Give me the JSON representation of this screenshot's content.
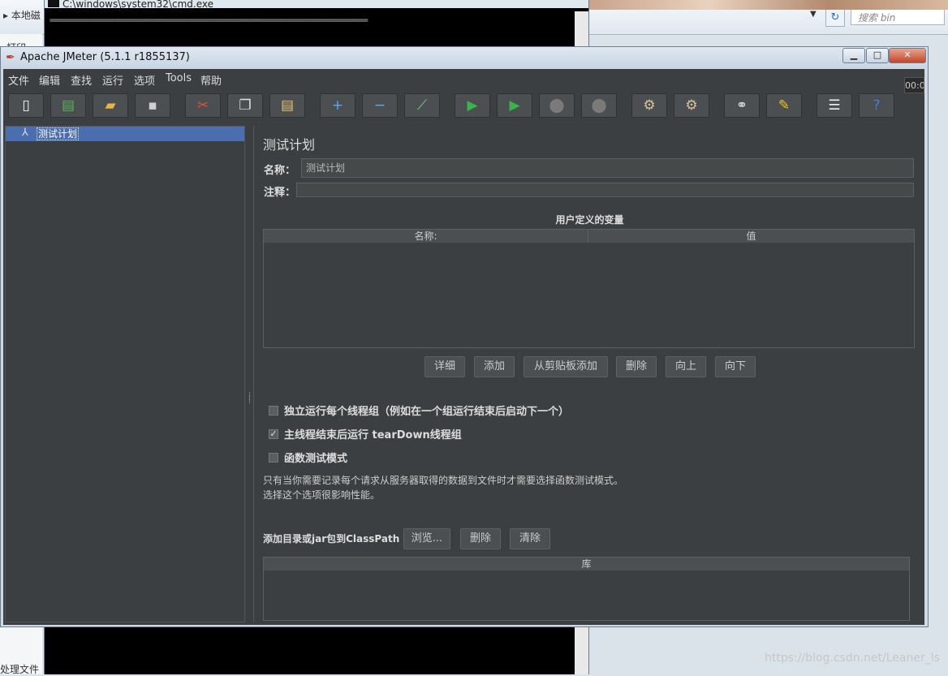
{
  "explorer": {
    "crumb": "▸ 本地磁",
    "search_placeholder": "搜索 bin",
    "left_top": "打印",
    "left_bottom": "处理文件"
  },
  "cmd": {
    "title": "C:\\windows\\system32\\cmd.exe",
    "line": "=============================================================================="
  },
  "watermark": "https://blog.csdn.net/Leaner_ls",
  "jmeter": {
    "title": "Apache JMeter (5.1.1 r1855137)",
    "window_buttons": [
      "▁",
      "□",
      "✕"
    ],
    "menu": [
      "文件",
      "编辑",
      "查找",
      "运行",
      "选项",
      "Tools",
      "帮助"
    ],
    "toolbar": [
      {
        "name": "new-icon",
        "glyph": "▯",
        "color": "#f4f4f4"
      },
      {
        "name": "templates-icon",
        "glyph": "▤",
        "color": "#57b35a"
      },
      {
        "name": "open-icon",
        "glyph": "▰",
        "color": "#e9b440"
      },
      {
        "name": "save-icon",
        "glyph": "▪",
        "color": "#cfcfcf"
      },
      {
        "name": "cut-icon",
        "glyph": "✂",
        "color": "#e74c3c"
      },
      {
        "name": "copy-icon",
        "glyph": "❐",
        "color": "#e0e0e0"
      },
      {
        "name": "paste-icon",
        "glyph": "▤",
        "color": "#e9c470"
      },
      {
        "name": "expand-icon",
        "glyph": "+",
        "color": "#5aa7f5"
      },
      {
        "name": "collapse-icon",
        "glyph": "−",
        "color": "#5aa7f5"
      },
      {
        "name": "toggle-icon",
        "glyph": "⟋",
        "color": "#8fc18f"
      },
      {
        "name": "start-icon",
        "glyph": "▶",
        "color": "#39b34a"
      },
      {
        "name": "start-no-pause-icon",
        "glyph": "▶",
        "color": "#39b34a"
      },
      {
        "name": "stop-icon",
        "glyph": "⬤",
        "color": "#7a7a7a"
      },
      {
        "name": "shutdown-icon",
        "glyph": "⬤",
        "color": "#7a7a7a"
      },
      {
        "name": "clear-icon",
        "glyph": "⚙",
        "color": "#d6c29a"
      },
      {
        "name": "clear-all-icon",
        "glyph": "⚙",
        "color": "#d6c29a"
      },
      {
        "name": "search-icon",
        "glyph": "⚭",
        "color": "#dddddd"
      },
      {
        "name": "reset-search-icon",
        "glyph": "✎",
        "color": "#f0c419"
      },
      {
        "name": "function-helper-icon",
        "glyph": "☰",
        "color": "#eeeeee"
      },
      {
        "name": "help-icon",
        "glyph": "?",
        "color": "#3d7fd9"
      }
    ],
    "timer": "00:0",
    "tree": {
      "root_label": "测试计划"
    },
    "plan": {
      "title": "测试计划",
      "name_label": "名称：",
      "name_value": "测试计划",
      "comment_label": "注释：",
      "comment_value": "",
      "vars_title": "用户定义的变量",
      "vars_columns": [
        "名称:",
        "值"
      ],
      "buttons": [
        "详细",
        "添加",
        "从剪贴板添加",
        "删除",
        "向上",
        "向下"
      ],
      "checkboxes": [
        {
          "label": "独立运行每个线程组（例如在一个组运行结束后启动下一个）",
          "checked": false
        },
        {
          "label": "主线程结束后运行 tearDown线程组",
          "checked": true
        },
        {
          "label": "函数测试模式",
          "checked": false
        }
      ],
      "note_line1": "只有当你需要记录每个请求从服务器取得的数据到文件时才需要选择函数测试模式。",
      "note_line2": "选择这个选项很影响性能。",
      "classpath_label": "添加目录或jar包到ClassPath",
      "classpath_buttons": [
        "浏览...",
        "删除",
        "清除"
      ],
      "lib_column": "库"
    }
  }
}
